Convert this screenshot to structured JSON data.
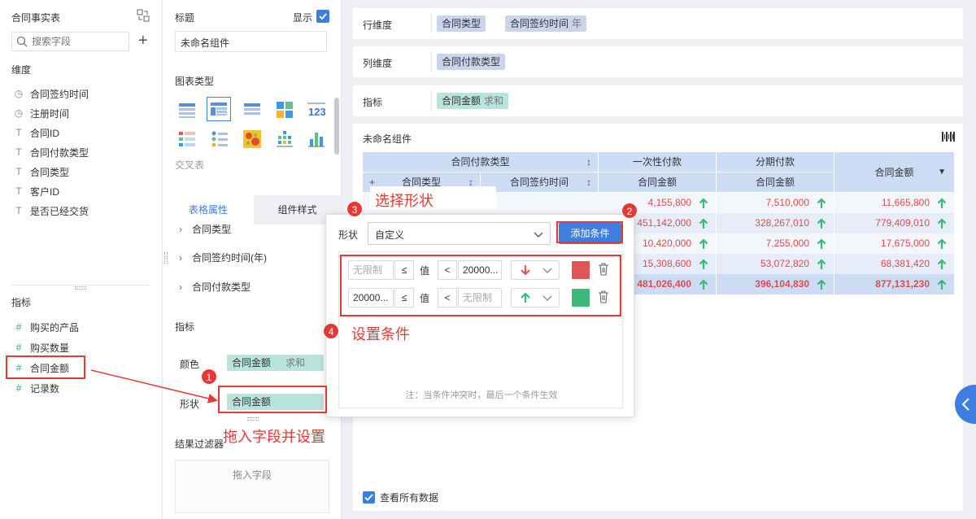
{
  "left_panel": {
    "title": "合同事实表",
    "search_placeholder": "搜索字段",
    "dimensions_label": "维度",
    "dimensions": [
      {
        "icon": "clock-icon",
        "label": "合同签约时间"
      },
      {
        "icon": "clock-icon",
        "label": "注册时间"
      },
      {
        "icon": "text-icon",
        "label": "合同ID"
      },
      {
        "icon": "text-icon",
        "label": "合同付款类型"
      },
      {
        "icon": "text-icon",
        "label": "合同类型"
      },
      {
        "icon": "text-icon",
        "label": "客户ID"
      },
      {
        "icon": "text-icon",
        "label": "是否已经交货"
      }
    ],
    "measures_label": "指标",
    "measures": [
      {
        "icon": "number-icon",
        "label": "购买的产品"
      },
      {
        "icon": "number-icon",
        "label": "购买数量"
      },
      {
        "icon": "number-icon",
        "label": "合同金额"
      },
      {
        "icon": "number-icon",
        "label": "记录数"
      }
    ]
  },
  "mid_panel": {
    "title_label": "标题",
    "show_label": "显示",
    "title_value": "未命名组件",
    "chart_type_label": "图表类型",
    "cross_table_label": "交叉表",
    "tab_active": "表格属性",
    "tab_inactive": "组件样式",
    "tree_items": [
      "合同类型",
      "合同签约时间(年)",
      "合同付款类型"
    ],
    "measure_label": "指标",
    "color_label": "颜色",
    "color_field": "合同金额",
    "color_agg": "求和",
    "shape_label": "形状",
    "shape_field": "合同金额",
    "filter_label": "结果过滤器",
    "filter_drop": "拖入字段"
  },
  "shelves": {
    "row_label": "行维度",
    "row_fields": [
      {
        "name": "合同类型",
        "sub": ""
      },
      {
        "name": "合同签约时间",
        "sub": "年"
      }
    ],
    "col_label": "列维度",
    "col_fields": [
      {
        "name": "合同付款类型",
        "sub": ""
      }
    ],
    "measure_label": "指标",
    "measure_fields": [
      {
        "name": "合同金额",
        "sub": "求和"
      }
    ]
  },
  "widget": {
    "title": "未命名组件",
    "header": {
      "group": "合同付款类型",
      "col1": "合同类型",
      "col2": "合同签约时间",
      "c1": "一次性付款",
      "c2": "分期付款",
      "total": "合同金额",
      "measure": "合同金额"
    },
    "rows": [
      {
        "v1": "4,155,800",
        "v2": "7,510,000",
        "v3": "11,665,800"
      },
      {
        "v1": "451,142,000",
        "v2": "328,267,010",
        "v3": "779,409,010"
      },
      {
        "v1": "10,420,000",
        "v2": "7,255,000",
        "v3": "17,675,000"
      },
      {
        "v1": "15,308,600",
        "v2": "53,072,820",
        "v3": "68,381,420"
      }
    ],
    "total_row": {
      "v1": "481,026,400",
      "v2": "396,104,830",
      "v3": "877,131,230"
    },
    "see_all": "查看所有数据"
  },
  "popup": {
    "shape_label": "形状",
    "shape_select": "自定义",
    "add_condition": "添加条件",
    "conditions": [
      {
        "min": "无限制",
        "op1": "≤",
        "value": "值",
        "op2": "<",
        "max": "20000...",
        "icon": "arrow-down-icon",
        "color": "#e05555"
      },
      {
        "min": "20000...",
        "op1": "≤",
        "value": "值",
        "op2": "<",
        "max": "无限制",
        "icon": "arrow-up-icon",
        "color": "#3cb878"
      }
    ],
    "note": "注：当条件冲突时，最后一个条件生效"
  },
  "annotations": {
    "a1": "1",
    "a1_text": "拖入字段并设置",
    "a2": "2",
    "a3": "3",
    "a3_text": "选择形状",
    "a4": "4",
    "a4_text": "设置条件"
  },
  "colors": {
    "accent": "#3d7ee0",
    "up": "#3cb878",
    "down": "#e05555",
    "annotation": "#e53935"
  }
}
